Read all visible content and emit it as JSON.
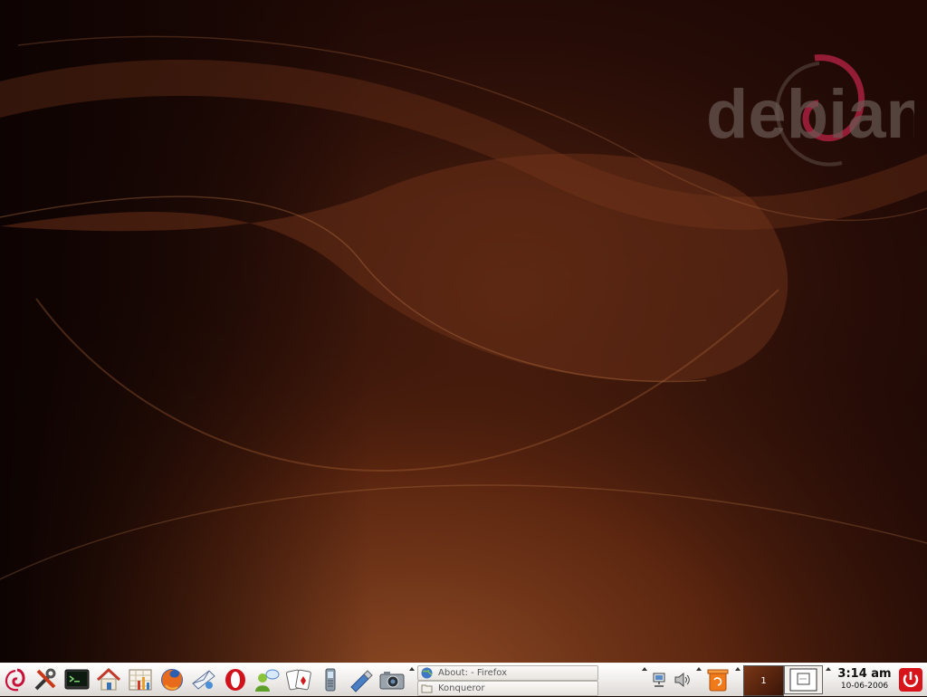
{
  "desktop": {
    "wallpaper_brand_text": "debian",
    "colors": {
      "bg_dark": "#1a0704",
      "bg_mid": "#5a220f",
      "bg_glow": "#8a4422",
      "logo_swirl": "#a8213e",
      "logo_text": "#6a5a55"
    }
  },
  "panel": {
    "launchers": [
      {
        "name": "debian-menu-icon"
      },
      {
        "name": "tools-icon"
      },
      {
        "name": "terminal-icon"
      },
      {
        "name": "home-icon"
      },
      {
        "name": "spreadsheet-icon"
      },
      {
        "name": "firefox-icon"
      },
      {
        "name": "email-icon"
      },
      {
        "name": "opera-icon"
      },
      {
        "name": "chat-icon"
      },
      {
        "name": "cards-game-icon"
      },
      {
        "name": "phone-icon"
      },
      {
        "name": "usb-drive-icon"
      },
      {
        "name": "camera-icon"
      }
    ],
    "taskbar": [
      {
        "label": "About: - Firefox",
        "icon": "globe-icon"
      },
      {
        "label": "Konqueror",
        "icon": "folder-icon"
      }
    ],
    "tray": [
      {
        "name": "network-icon"
      },
      {
        "name": "volume-icon"
      },
      {
        "name": "trash-icon"
      }
    ],
    "pager": {
      "desktop_number": "1"
    },
    "clock": {
      "time": "3:14 am",
      "date": "10-06-2006"
    },
    "logout_icon": "power-icon"
  }
}
